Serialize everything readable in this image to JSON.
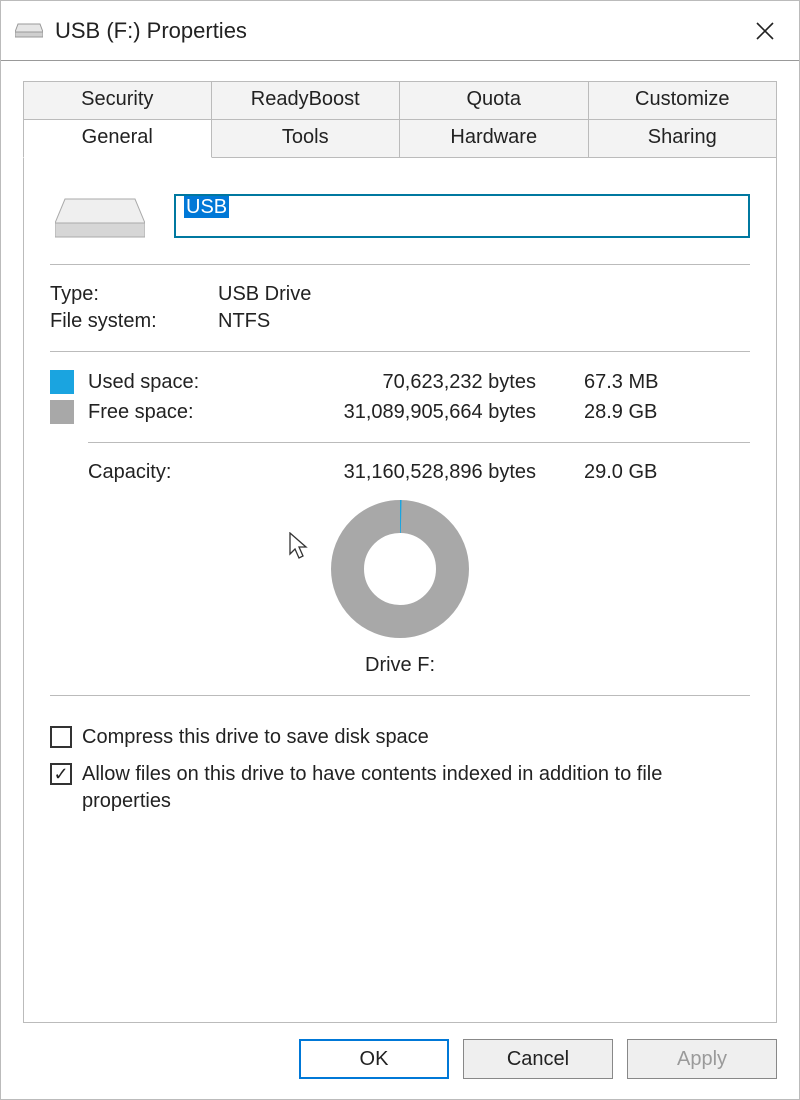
{
  "window": {
    "title": "USB (F:) Properties"
  },
  "tabs": {
    "row1": [
      "Security",
      "ReadyBoost",
      "Quota",
      "Customize"
    ],
    "row2": [
      "General",
      "Tools",
      "Hardware",
      "Sharing"
    ],
    "active": "General"
  },
  "general": {
    "drive_name": "USB",
    "type_label": "Type:",
    "type_value": "USB Drive",
    "fs_label": "File system:",
    "fs_value": "NTFS",
    "used_label": "Used space:",
    "used_bytes": "70,623,232 bytes",
    "used_human": "67.3 MB",
    "free_label": "Free space:",
    "free_bytes": "31,089,905,664 bytes",
    "free_human": "28.9 GB",
    "capacity_label": "Capacity:",
    "capacity_bytes": "31,160,528,896 bytes",
    "capacity_human": "29.0 GB",
    "drive_label": "Drive F:",
    "colors": {
      "used": "#1aa4e0",
      "free": "#a8a8a8"
    },
    "compress_label": "Compress this drive to save disk space",
    "compress_checked": false,
    "index_label": "Allow files on this drive to have contents indexed in addition to file properties",
    "index_checked": true
  },
  "buttons": {
    "ok": "OK",
    "cancel": "Cancel",
    "apply": "Apply"
  },
  "chart_data": {
    "type": "pie",
    "title": "Drive F:",
    "series": [
      {
        "name": "Used space",
        "value": 70623232,
        "human": "67.3 MB",
        "color": "#1aa4e0"
      },
      {
        "name": "Free space",
        "value": 31089905664,
        "human": "28.9 GB",
        "color": "#a8a8a8"
      }
    ],
    "total": {
      "name": "Capacity",
      "value": 31160528896,
      "human": "29.0 GB"
    }
  }
}
